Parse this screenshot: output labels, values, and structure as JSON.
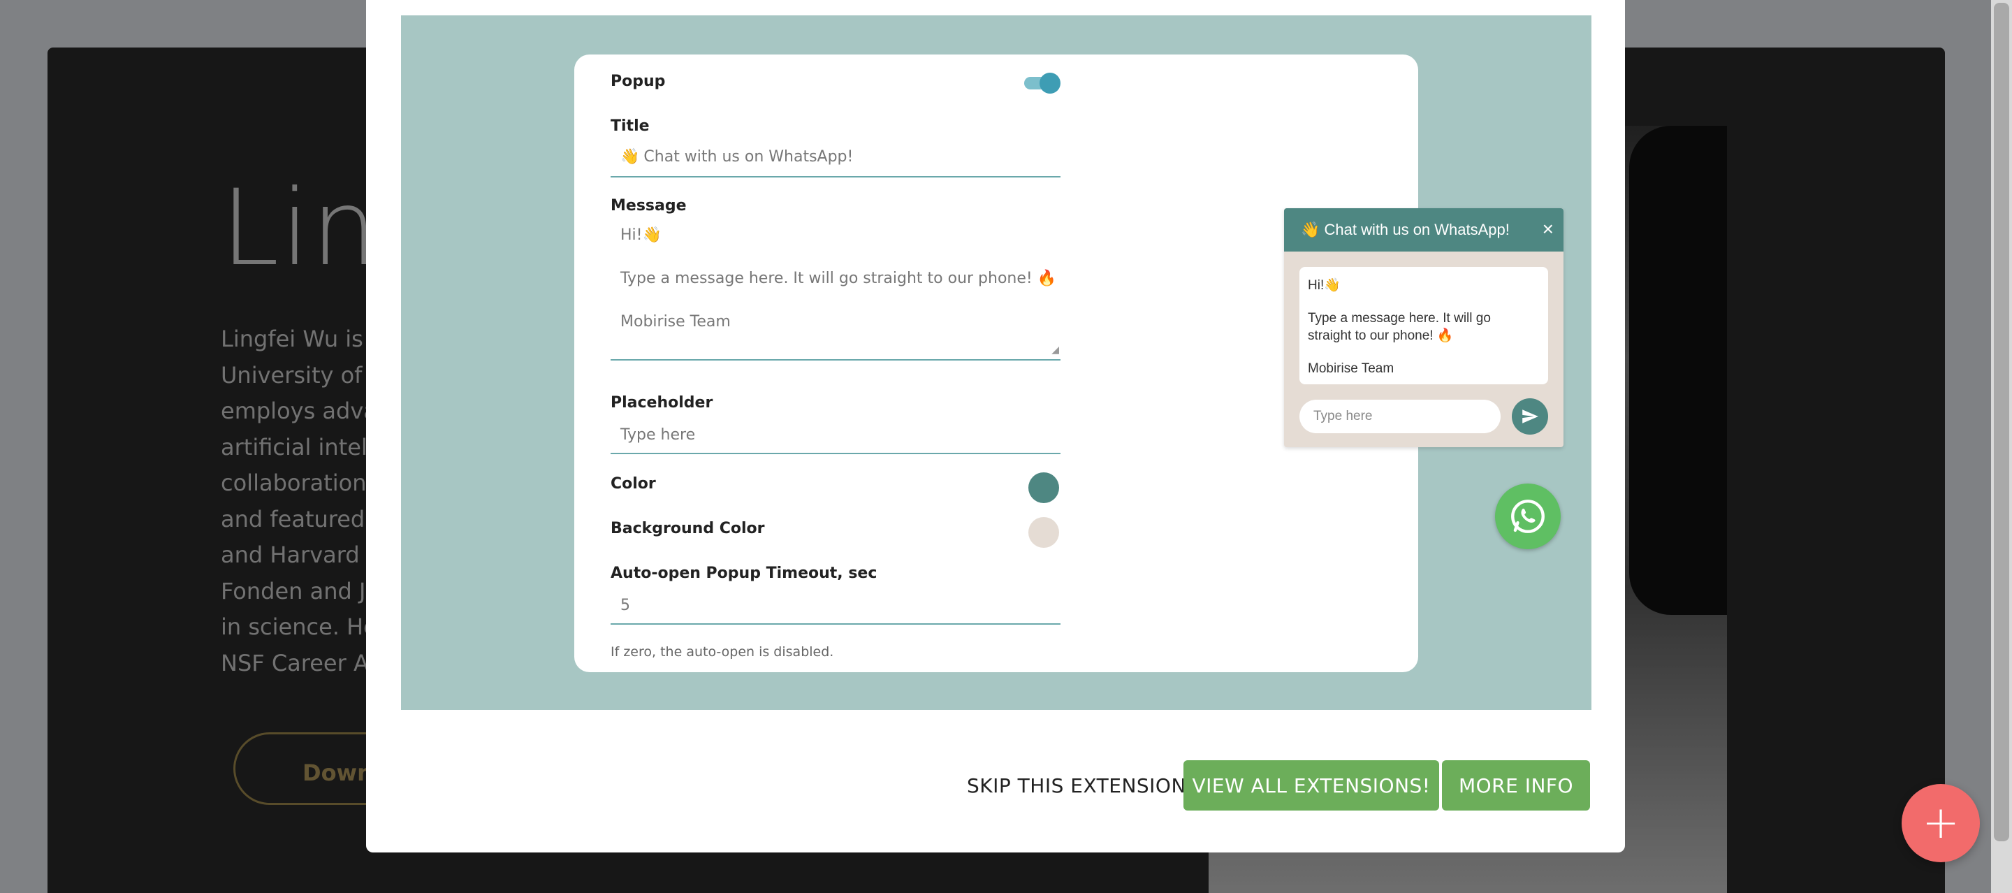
{
  "background": {
    "heading": "Ling",
    "bio_lines": [
      "Lingfei Wu is a",
      "University of P",
      "employs advan",
      "artificial intellig",
      "collaboration.",
      "and featured i",
      "and Harvard B",
      "Fonden and Jo",
      "in science. He",
      "NSF Career Aw"
    ],
    "button_label": "Down"
  },
  "settings": {
    "popup_label": "Popup",
    "popup_enabled": true,
    "title_label": "Title",
    "title_emoji": "👋",
    "title_value": "Chat with us on WhatsApp!",
    "message_label": "Message",
    "message_line1": "Hi!👋",
    "message_line2": "Type a message here. It will go straight to our phone! 🔥",
    "message_line3": "Mobirise Team",
    "placeholder_label": "Placeholder",
    "placeholder_value": "Type here",
    "color_label": "Color",
    "color_value": "#4e8782",
    "bg_color_label": "Background Color",
    "bg_color_value": "#e5dcd4",
    "timeout_label": "Auto-open Popup Timeout, sec",
    "timeout_value": "5",
    "timeout_help": "If zero, the auto-open is disabled."
  },
  "preview": {
    "header_emoji": "👋",
    "header_title": "Chat with us on WhatsApp!",
    "close_symbol": "×",
    "greeting": "Hi!👋",
    "body_line1": "Type a message here. It will go",
    "body_line2": "straight to our phone! 🔥",
    "signature": "Mobirise Team",
    "input_placeholder": "Type here"
  },
  "footer": {
    "skip_label": "SKIP THIS EXTENSION",
    "view_all_label": "VIEW ALL EXTENSIONS!",
    "more_info_label": "MORE INFO"
  },
  "fab_symbol": "+"
}
